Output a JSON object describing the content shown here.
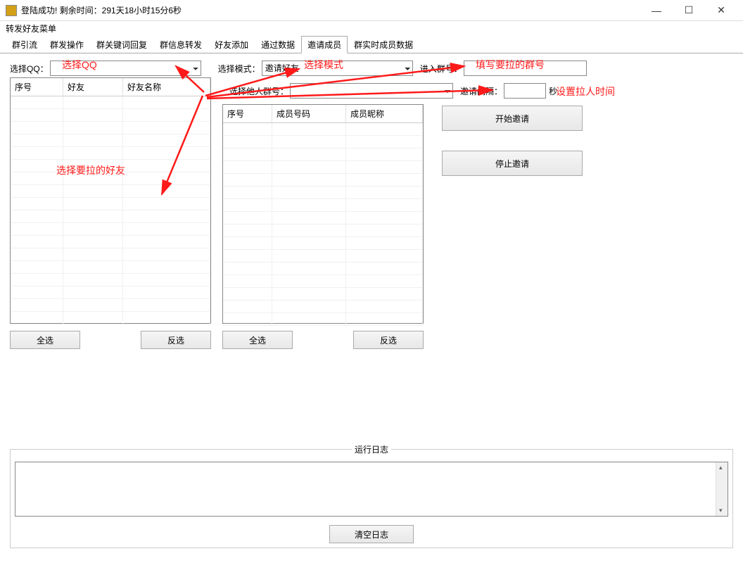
{
  "window": {
    "title": "登陆成功! 剩余时间：291天18小时15分6秒",
    "menu": "转发好友菜单"
  },
  "tabs": [
    "群引流",
    "群发操作",
    "群关键词回复",
    "群信息转发",
    "好友添加",
    "通过数据",
    "邀请成员",
    "群实时成员数据"
  ],
  "active_tab_index": 6,
  "row1": {
    "select_qq_label": "选择QQ：",
    "select_mode_label": "选择模式：",
    "select_mode_value": "邀请好友",
    "enter_group_label": "进入群号："
  },
  "row2": {
    "other_group_label": "选择他人群号：",
    "invite_interval_label": "邀请间隔：",
    "seconds_label": "秒"
  },
  "table_left": {
    "headers": [
      "序号",
      "好友",
      "好友名称"
    ]
  },
  "table_right": {
    "headers": [
      "序号",
      "成员号码",
      "成员昵称"
    ]
  },
  "buttons": {
    "select_all": "全选",
    "invert": "反选",
    "start_invite": "开始邀请",
    "stop_invite": "停止邀请",
    "clear_log": "清空日志"
  },
  "log_title": "运行日志",
  "annotations": {
    "a1": "选择QQ",
    "a2": "选择模式",
    "a3": "填写要拉的群号",
    "a4": "设置拉人时间",
    "a5": "选择要拉的好友"
  }
}
